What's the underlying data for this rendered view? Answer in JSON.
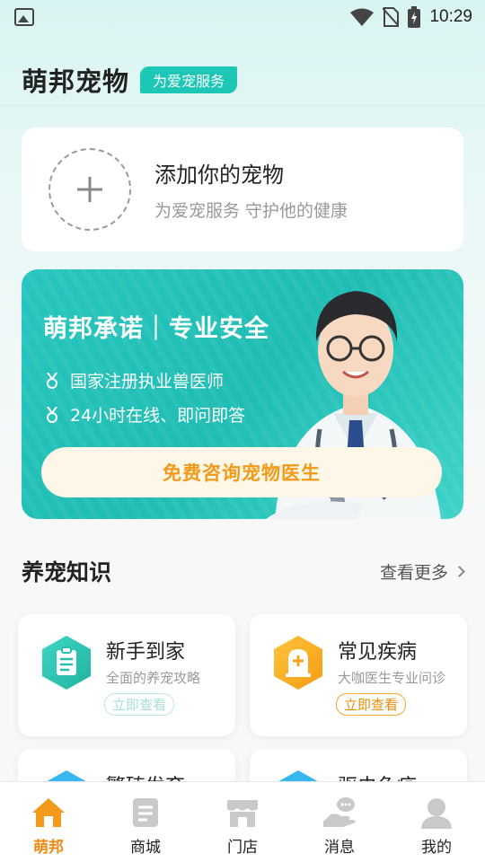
{
  "status_bar": {
    "time": "10:29"
  },
  "header": {
    "app_title": "萌邦宠物",
    "tag": "为爱宠服务"
  },
  "add_pet": {
    "title": "添加你的宠物",
    "subtitle": "为爱宠服务 守护他的健康"
  },
  "banner": {
    "title": "萌邦承诺｜专业安全",
    "lines": [
      "国家注册执业兽医师",
      "24小时在线、即问即答"
    ],
    "button": "免费咨询宠物医生"
  },
  "knowledge": {
    "title": "养宠知识",
    "more": "查看更多",
    "cards": [
      {
        "title": "新手到家",
        "desc": "全面的养宠攻略",
        "button": "立即查看",
        "icon": "clipboard-icon"
      },
      {
        "title": "常见疾病",
        "desc": "大咖医生专业问诊",
        "button": "立即查看",
        "icon": "tombstone-plus-icon"
      },
      {
        "title": "繁殖发育",
        "icon": "hexagon-icon"
      },
      {
        "title": "驱虫免疫",
        "icon": "hexagon-icon"
      }
    ]
  },
  "tabs": [
    {
      "label": "萌邦",
      "icon": "home-icon",
      "active": true
    },
    {
      "label": "商城",
      "icon": "list-doc-icon"
    },
    {
      "label": "门店",
      "icon": "store-icon"
    },
    {
      "label": "消息",
      "icon": "chat-hand-icon"
    },
    {
      "label": "我的",
      "icon": "person-icon"
    }
  ],
  "colors": {
    "accent": "#1cc7b6",
    "orange": "#f08a12",
    "button_bg": "#fef6e6"
  }
}
